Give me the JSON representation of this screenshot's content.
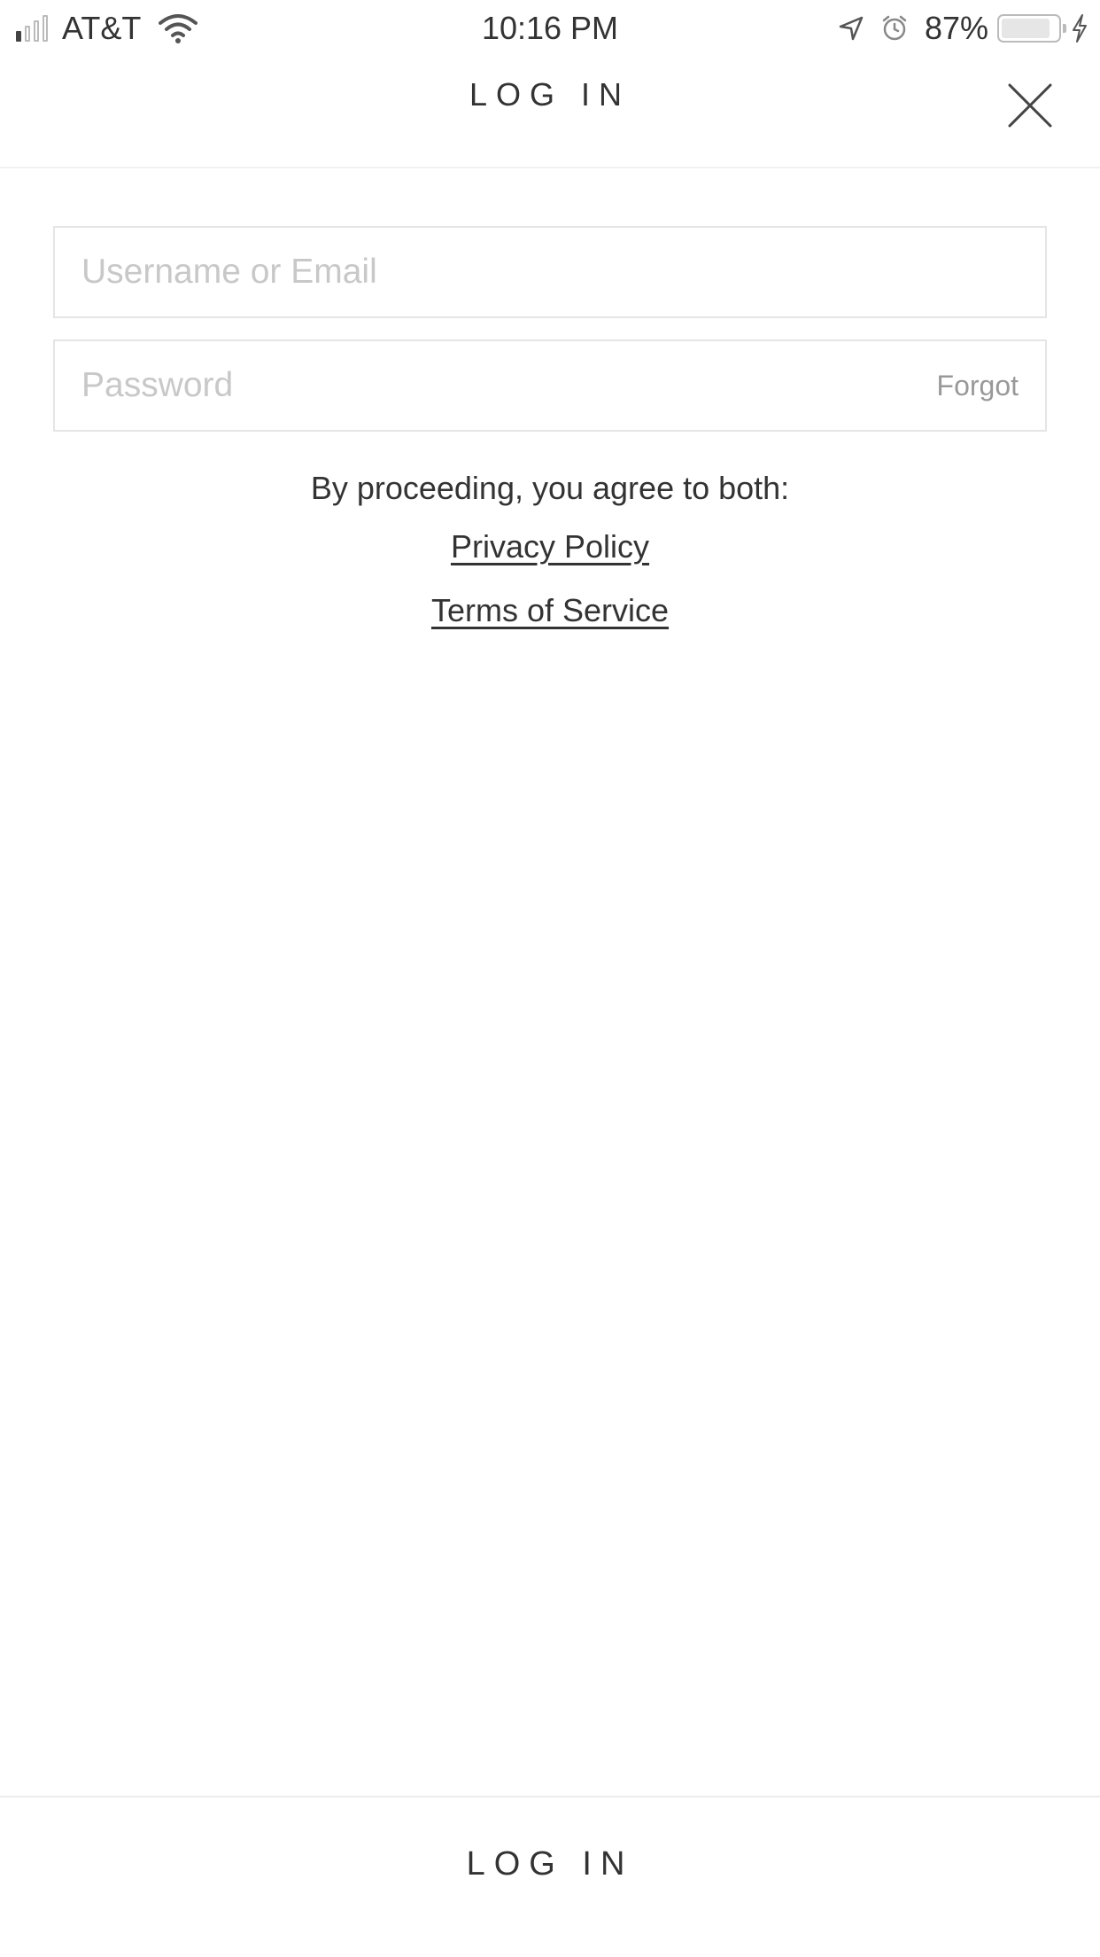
{
  "status_bar": {
    "carrier": "AT&T",
    "time": "10:16 PM",
    "battery_percent": "87%",
    "battery_level": 0.87,
    "signal_bars_active": 1,
    "signal_bars_total": 4,
    "icons": [
      "signal-icon",
      "wifi-icon",
      "location-arrow-icon",
      "alarm-icon",
      "battery-icon",
      "charging-bolt-icon"
    ]
  },
  "header": {
    "title": "LOG IN",
    "close_icon": "close-icon"
  },
  "form": {
    "username": {
      "value": "",
      "placeholder": "Username or Email"
    },
    "password": {
      "value": "",
      "placeholder": "Password",
      "forgot_label": "Forgot"
    }
  },
  "legal": {
    "agree_text": "By proceeding, you agree to both:",
    "privacy_label": "Privacy Policy",
    "terms_label": "Terms of Service"
  },
  "footer": {
    "login_label": "LOG IN"
  },
  "colors": {
    "text": "#333333",
    "placeholder": "#c8c8c8",
    "border": "#e5e5e5",
    "muted": "#999999",
    "background": "#ffffff"
  }
}
